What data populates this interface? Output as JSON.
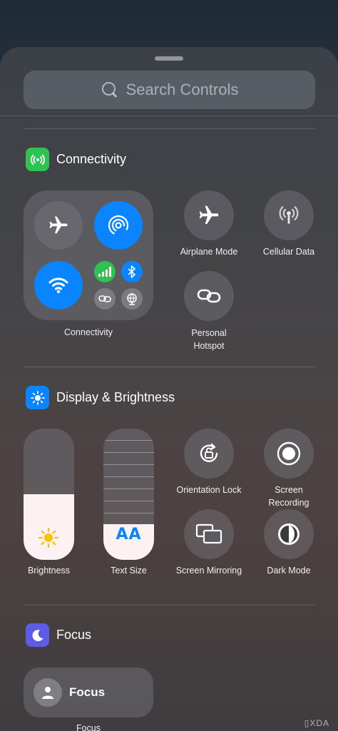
{
  "search": {
    "placeholder": "Search Controls"
  },
  "sections": {
    "connectivity": {
      "title": "Connectivity",
      "color": "#30c153"
    },
    "display": {
      "title": "Display & Brightness",
      "color": "#0a84ff"
    },
    "focus": {
      "title": "Focus",
      "color": "#5e5ce6"
    }
  },
  "connectivity": {
    "group_label": "Connectivity",
    "airplane_label": "Airplane Mode",
    "cellular_label": "Cellular Data",
    "hotspot_label": "Personal Hotspot"
  },
  "display": {
    "brightness_label": "Brightness",
    "text_size_label": "Text Size",
    "text_size_glyph": "AA",
    "orientation_label": "Orientation Lock",
    "recording_label": "Screen Recording",
    "mirroring_label": "Screen Mirroring",
    "dark_mode_label": "Dark Mode",
    "brightness_level": 0.5
  },
  "focus": {
    "tile_label": "Focus",
    "caption": "Focus"
  },
  "watermark": "XDA",
  "colors": {
    "accent_blue": "#0a84ff",
    "green": "#30c153",
    "indigo": "#5e5ce6"
  }
}
